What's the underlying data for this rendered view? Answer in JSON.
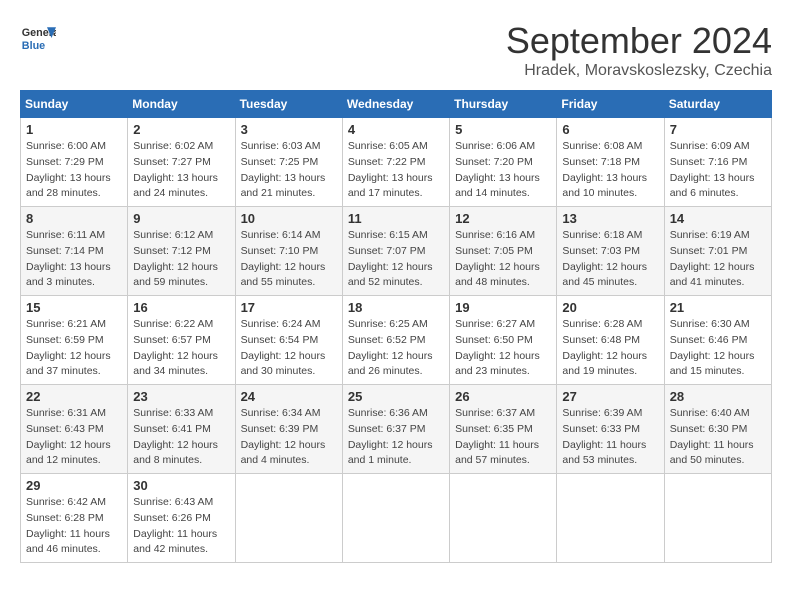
{
  "header": {
    "logo_line1": "General",
    "logo_line2": "Blue",
    "month": "September 2024",
    "location": "Hradek, Moravskoslezsky, Czechia"
  },
  "weekdays": [
    "Sunday",
    "Monday",
    "Tuesday",
    "Wednesday",
    "Thursday",
    "Friday",
    "Saturday"
  ],
  "weeks": [
    [
      {
        "day": "1",
        "sunrise": "Sunrise: 6:00 AM",
        "sunset": "Sunset: 7:29 PM",
        "daylight": "Daylight: 13 hours and 28 minutes."
      },
      {
        "day": "2",
        "sunrise": "Sunrise: 6:02 AM",
        "sunset": "Sunset: 7:27 PM",
        "daylight": "Daylight: 13 hours and 24 minutes."
      },
      {
        "day": "3",
        "sunrise": "Sunrise: 6:03 AM",
        "sunset": "Sunset: 7:25 PM",
        "daylight": "Daylight: 13 hours and 21 minutes."
      },
      {
        "day": "4",
        "sunrise": "Sunrise: 6:05 AM",
        "sunset": "Sunset: 7:22 PM",
        "daylight": "Daylight: 13 hours and 17 minutes."
      },
      {
        "day": "5",
        "sunrise": "Sunrise: 6:06 AM",
        "sunset": "Sunset: 7:20 PM",
        "daylight": "Daylight: 13 hours and 14 minutes."
      },
      {
        "day": "6",
        "sunrise": "Sunrise: 6:08 AM",
        "sunset": "Sunset: 7:18 PM",
        "daylight": "Daylight: 13 hours and 10 minutes."
      },
      {
        "day": "7",
        "sunrise": "Sunrise: 6:09 AM",
        "sunset": "Sunset: 7:16 PM",
        "daylight": "Daylight: 13 hours and 6 minutes."
      }
    ],
    [
      {
        "day": "8",
        "sunrise": "Sunrise: 6:11 AM",
        "sunset": "Sunset: 7:14 PM",
        "daylight": "Daylight: 13 hours and 3 minutes."
      },
      {
        "day": "9",
        "sunrise": "Sunrise: 6:12 AM",
        "sunset": "Sunset: 7:12 PM",
        "daylight": "Daylight: 12 hours and 59 minutes."
      },
      {
        "day": "10",
        "sunrise": "Sunrise: 6:14 AM",
        "sunset": "Sunset: 7:10 PM",
        "daylight": "Daylight: 12 hours and 55 minutes."
      },
      {
        "day": "11",
        "sunrise": "Sunrise: 6:15 AM",
        "sunset": "Sunset: 7:07 PM",
        "daylight": "Daylight: 12 hours and 52 minutes."
      },
      {
        "day": "12",
        "sunrise": "Sunrise: 6:16 AM",
        "sunset": "Sunset: 7:05 PM",
        "daylight": "Daylight: 12 hours and 48 minutes."
      },
      {
        "day": "13",
        "sunrise": "Sunrise: 6:18 AM",
        "sunset": "Sunset: 7:03 PM",
        "daylight": "Daylight: 12 hours and 45 minutes."
      },
      {
        "day": "14",
        "sunrise": "Sunrise: 6:19 AM",
        "sunset": "Sunset: 7:01 PM",
        "daylight": "Daylight: 12 hours and 41 minutes."
      }
    ],
    [
      {
        "day": "15",
        "sunrise": "Sunrise: 6:21 AM",
        "sunset": "Sunset: 6:59 PM",
        "daylight": "Daylight: 12 hours and 37 minutes."
      },
      {
        "day": "16",
        "sunrise": "Sunrise: 6:22 AM",
        "sunset": "Sunset: 6:57 PM",
        "daylight": "Daylight: 12 hours and 34 minutes."
      },
      {
        "day": "17",
        "sunrise": "Sunrise: 6:24 AM",
        "sunset": "Sunset: 6:54 PM",
        "daylight": "Daylight: 12 hours and 30 minutes."
      },
      {
        "day": "18",
        "sunrise": "Sunrise: 6:25 AM",
        "sunset": "Sunset: 6:52 PM",
        "daylight": "Daylight: 12 hours and 26 minutes."
      },
      {
        "day": "19",
        "sunrise": "Sunrise: 6:27 AM",
        "sunset": "Sunset: 6:50 PM",
        "daylight": "Daylight: 12 hours and 23 minutes."
      },
      {
        "day": "20",
        "sunrise": "Sunrise: 6:28 AM",
        "sunset": "Sunset: 6:48 PM",
        "daylight": "Daylight: 12 hours and 19 minutes."
      },
      {
        "day": "21",
        "sunrise": "Sunrise: 6:30 AM",
        "sunset": "Sunset: 6:46 PM",
        "daylight": "Daylight: 12 hours and 15 minutes."
      }
    ],
    [
      {
        "day": "22",
        "sunrise": "Sunrise: 6:31 AM",
        "sunset": "Sunset: 6:43 PM",
        "daylight": "Daylight: 12 hours and 12 minutes."
      },
      {
        "day": "23",
        "sunrise": "Sunrise: 6:33 AM",
        "sunset": "Sunset: 6:41 PM",
        "daylight": "Daylight: 12 hours and 8 minutes."
      },
      {
        "day": "24",
        "sunrise": "Sunrise: 6:34 AM",
        "sunset": "Sunset: 6:39 PM",
        "daylight": "Daylight: 12 hours and 4 minutes."
      },
      {
        "day": "25",
        "sunrise": "Sunrise: 6:36 AM",
        "sunset": "Sunset: 6:37 PM",
        "daylight": "Daylight: 12 hours and 1 minute."
      },
      {
        "day": "26",
        "sunrise": "Sunrise: 6:37 AM",
        "sunset": "Sunset: 6:35 PM",
        "daylight": "Daylight: 11 hours and 57 minutes."
      },
      {
        "day": "27",
        "sunrise": "Sunrise: 6:39 AM",
        "sunset": "Sunset: 6:33 PM",
        "daylight": "Daylight: 11 hours and 53 minutes."
      },
      {
        "day": "28",
        "sunrise": "Sunrise: 6:40 AM",
        "sunset": "Sunset: 6:30 PM",
        "daylight": "Daylight: 11 hours and 50 minutes."
      }
    ],
    [
      {
        "day": "29",
        "sunrise": "Sunrise: 6:42 AM",
        "sunset": "Sunset: 6:28 PM",
        "daylight": "Daylight: 11 hours and 46 minutes."
      },
      {
        "day": "30",
        "sunrise": "Sunrise: 6:43 AM",
        "sunset": "Sunset: 6:26 PM",
        "daylight": "Daylight: 11 hours and 42 minutes."
      },
      null,
      null,
      null,
      null,
      null
    ]
  ]
}
